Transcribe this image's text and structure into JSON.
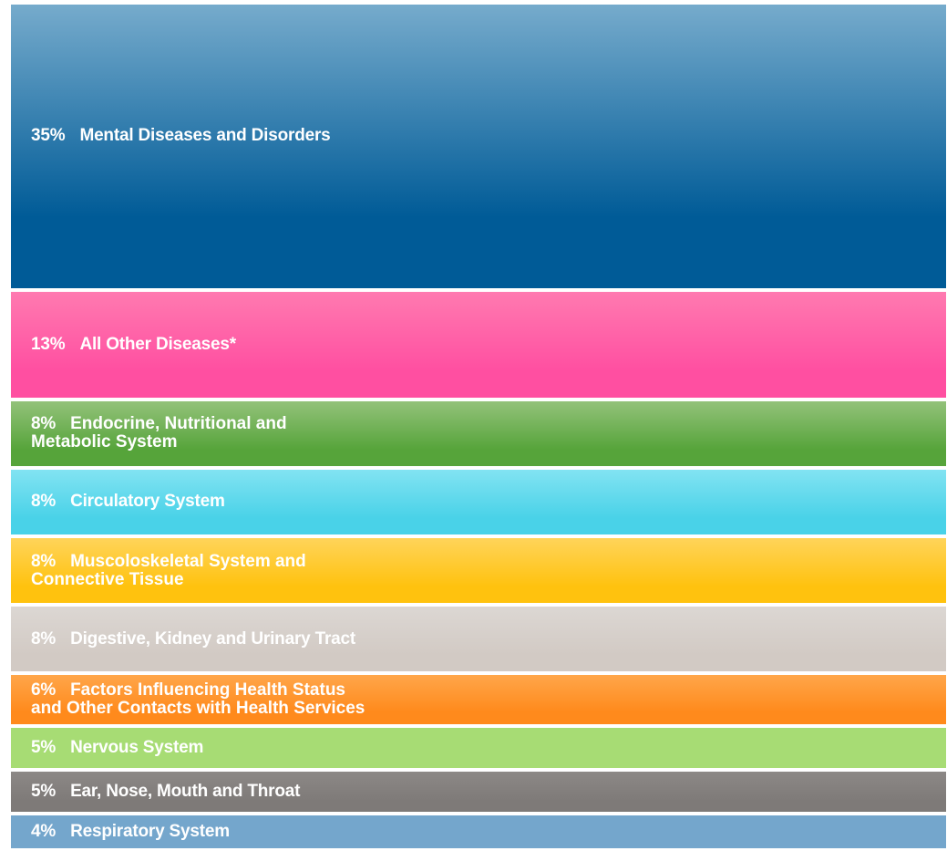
{
  "chart_data": {
    "type": "bar",
    "orientation": "horizontal-stacked-strips",
    "title": "",
    "xlabel": "",
    "ylabel": "",
    "unit": "%",
    "categories": [
      "Mental Diseases and Disorders",
      "All Other Diseases*",
      "Endocrine, Nutritional and\nMetabolic System",
      "Circulatory System",
      "Muscoloskeletal System and\nConnective Tissue",
      "Digestive, Kidney and Urinary Tract",
      "Factors Influencing Health Status\nand Other Contacts with Health Services",
      "Nervous System",
      "Ear, Nose, Mouth and Throat",
      "Respiratory System"
    ],
    "values": [
      35,
      13,
      8,
      8,
      8,
      8,
      6,
      5,
      5,
      4
    ],
    "value_labels": [
      "35%",
      "13%",
      "8%",
      "8%",
      "8%",
      "8%",
      "6%",
      "5%",
      "5%",
      "4%"
    ],
    "colors": [
      [
        "#76abcc",
        "#005b97"
      ],
      [
        "#ff7ab0",
        "#ff4fa1"
      ],
      [
        "#93c27a",
        "#56a43a"
      ],
      [
        "#82e3f2",
        "#49d2e8"
      ],
      [
        "#ffd45a",
        "#ffc20e"
      ],
      [
        "#dcd7d3",
        "#d2cac4"
      ],
      [
        "#ffa64a",
        "#ff8a1c"
      ],
      [
        "#a7dc74",
        "#a7dc74"
      ],
      [
        "#8c8886",
        "#7e7a78"
      ],
      [
        "#74a6cc",
        "#74a6cc"
      ]
    ],
    "label_vertical_position": [
      "upper",
      "center",
      "center",
      "center",
      "center",
      "center",
      "center",
      "center",
      "center",
      "center"
    ]
  }
}
